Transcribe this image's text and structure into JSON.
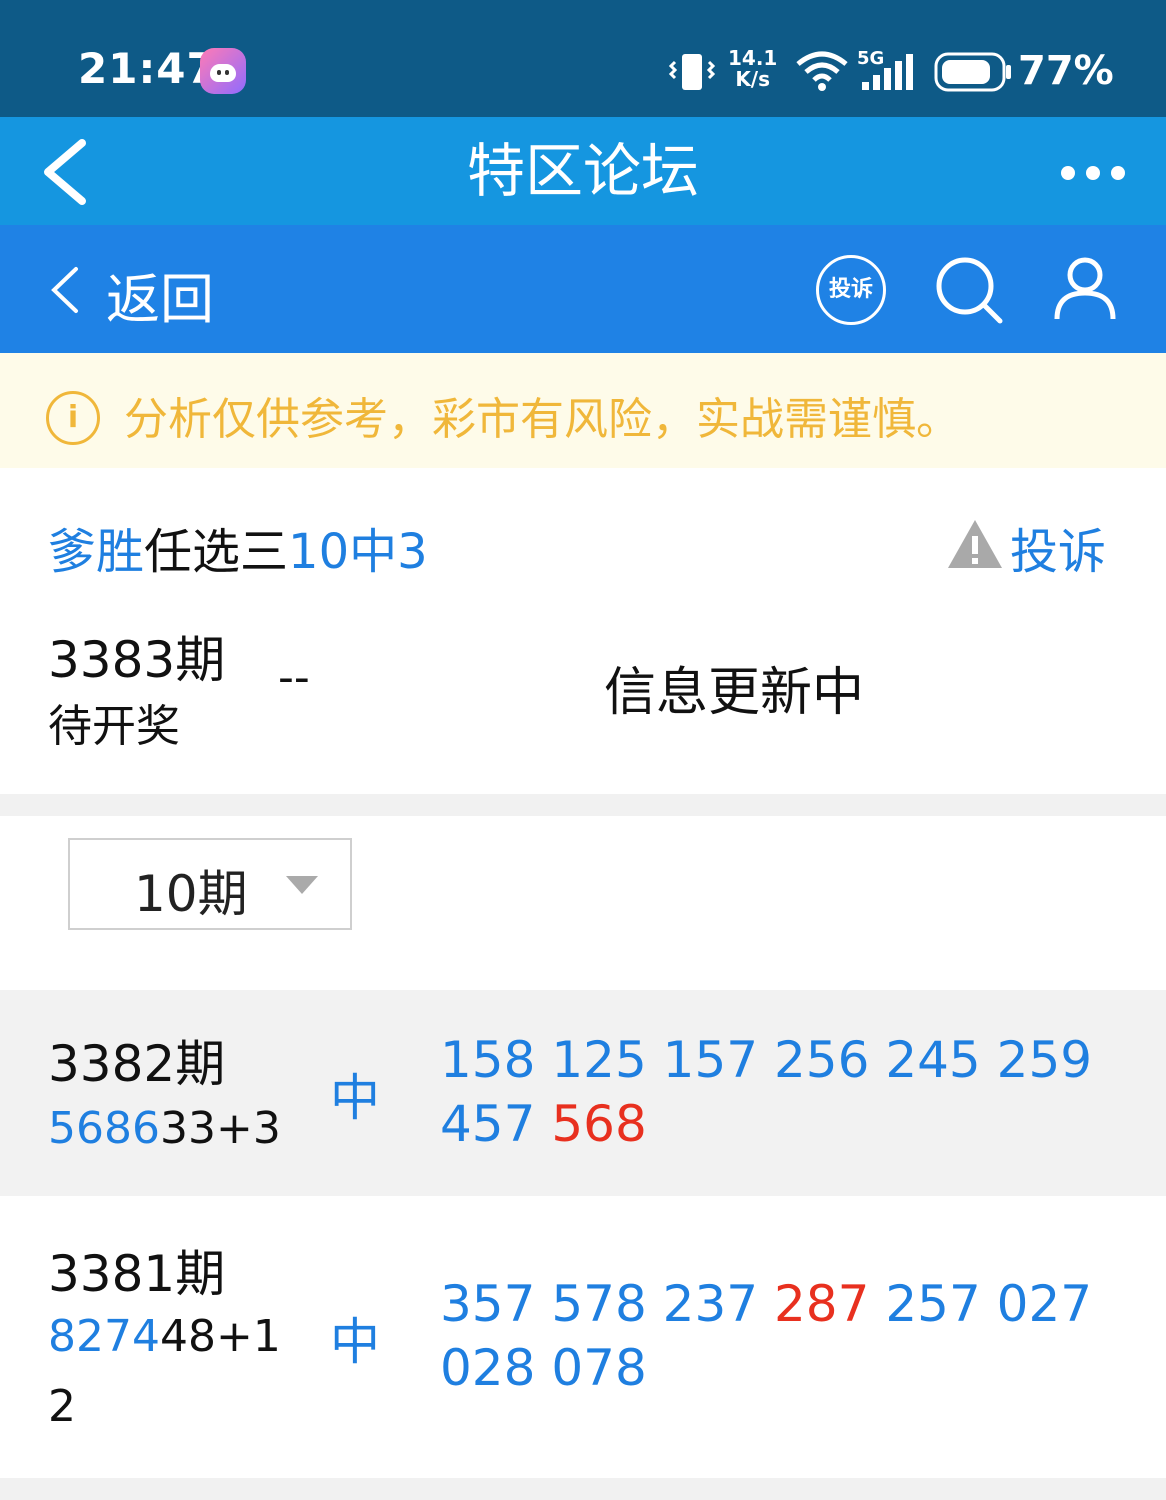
{
  "status_bar": {
    "time": "21:47",
    "speed_value": "14.1",
    "speed_unit": "K/s",
    "network": "5G",
    "battery": "77%"
  },
  "title_bar": {
    "title": "特区论坛"
  },
  "sub_nav": {
    "back_label": "返回",
    "complain_label": "投诉"
  },
  "notice": {
    "text": "分析仅供参考，彩市有风险，实战需谨慎。"
  },
  "header": {
    "name_prefix": "爹胜",
    "name_middle": "任选三",
    "name_suffix": "10中3",
    "report_label": "投诉"
  },
  "current": {
    "issue": "3383期",
    "status": "待开奖",
    "dash": "--",
    "message": "信息更新中"
  },
  "period_select": {
    "value": "10期"
  },
  "rows": [
    {
      "issue": "3382期",
      "draw_hit": "5686",
      "draw_rest": "33+3",
      "result": "中",
      "numbers_before": "158 125 157 256 245 259 457 ",
      "numbers_hit": "568",
      "numbers_after": ""
    },
    {
      "issue": "3381期",
      "draw_hit": "8274",
      "draw_rest": "48+12",
      "result": "中",
      "numbers_before": "357 578 237 ",
      "numbers_hit": "287",
      "numbers_after": " 257 027 028 078"
    }
  ],
  "colors": {
    "status_bar": "#0e5a87",
    "title_bar": "#1596e0",
    "sub_nav": "#1f82e5",
    "accent_blue": "#1f7fe0",
    "hit_red": "#e8301f",
    "warning": "#f0b73a"
  },
  "icons": [
    "app-badge-icon",
    "vibrate-icon",
    "wifi-icon",
    "signal-icon",
    "battery-icon",
    "back-arrow-icon",
    "more-icon",
    "back-chevron-icon",
    "search-icon",
    "user-icon",
    "info-icon",
    "warning-triangle-icon",
    "dropdown-arrow-icon"
  ]
}
